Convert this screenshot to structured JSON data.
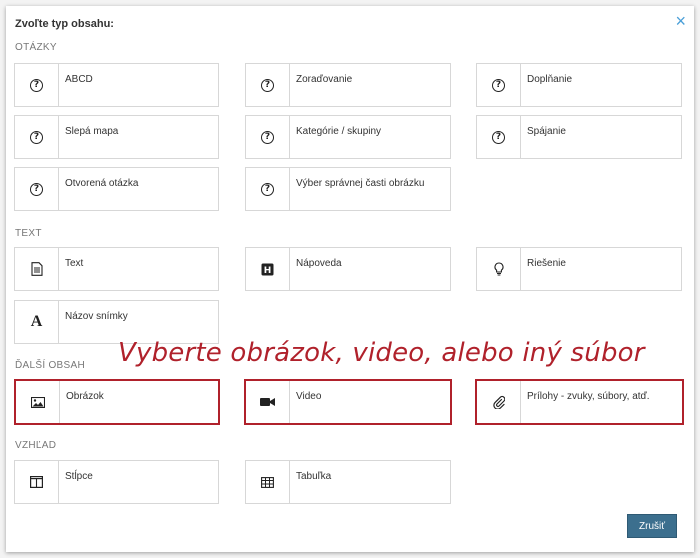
{
  "dialog": {
    "title": "Zvoľte typ obsahu:",
    "close_icon": "×",
    "cancel_label": "Zrušiť"
  },
  "sections": {
    "questions": "OTÁZKY",
    "text": "TEXT",
    "other": "ĎALŠÍ OBSAH",
    "layout": "VZHĽAD"
  },
  "questions": [
    {
      "label": "ABCD",
      "icon": "question-icon"
    },
    {
      "label": "Zoraďovanie",
      "icon": "question-icon"
    },
    {
      "label": "Doplňanie",
      "icon": "question-icon"
    },
    {
      "label": "Slepá mapa",
      "icon": "question-icon"
    },
    {
      "label": "Kategórie / skupiny",
      "icon": "question-icon"
    },
    {
      "label": "Spájanie",
      "icon": "question-icon"
    },
    {
      "label": "Otvorená otázka",
      "icon": "question-icon"
    },
    {
      "label": "Výber správnej časti obrázku",
      "icon": "question-icon"
    }
  ],
  "text_items": [
    {
      "label": "Text",
      "icon": "document-icon"
    },
    {
      "label": "Nápoveda",
      "icon": "help-box-icon"
    },
    {
      "label": "Riešenie",
      "icon": "lightbulb-icon"
    },
    {
      "label": "Názov snímky",
      "icon": "font-a-icon"
    }
  ],
  "other_items": [
    {
      "label": "Obrázok",
      "icon": "image-icon"
    },
    {
      "label": "Video",
      "icon": "video-camera-icon"
    },
    {
      "label": "Prílohy - zvuky, súbory, atď.",
      "icon": "paperclip-icon"
    }
  ],
  "layout_items": [
    {
      "label": "Stĺpce",
      "icon": "columns-icon"
    },
    {
      "label": "Tabuľka",
      "icon": "table-icon"
    }
  ],
  "annotation": {
    "callout_text": "Vyberte obrázok, video, alebo iný súbor",
    "highlight_color": "#b0212b"
  }
}
